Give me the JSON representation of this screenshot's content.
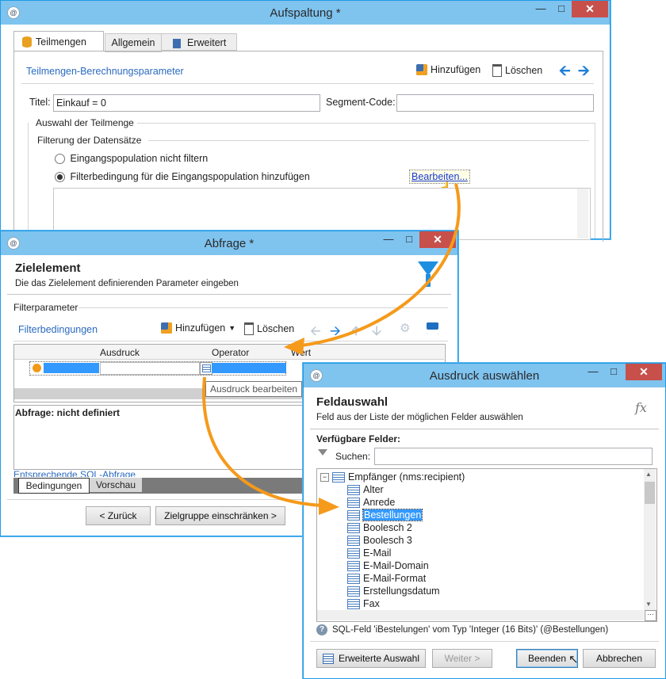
{
  "win1": {
    "title": "Aufspaltung *",
    "tabs": [
      "Teilmengen",
      "Allgemein",
      "Erweitert"
    ],
    "section_label": "Teilmengen-Berechnungsparameter",
    "add_label": "Hinzufügen",
    "delete_label": "Löschen",
    "title_label": "Titel:",
    "title_value": "Einkauf = 0",
    "segment_label": "Segment-Code:",
    "segment_value": "",
    "subset_group": "Auswahl der Teilmenge",
    "filter_group": "Filterung der Datensätze",
    "radio1": "Eingangspopulation nicht filtern",
    "radio2": "Filterbedingung für die Eingangspopulation hinzufügen",
    "edit_link": "Bearbeiten..."
  },
  "win2": {
    "title": "Abfrage *",
    "heading": "Zielelement",
    "subheading": "Die das Zielelement definierenden Parameter eingeben",
    "filter_params": "Filterparameter",
    "filter_conditions": "Filterbedingungen",
    "add_label": "Hinzufügen",
    "delete_label": "Löschen",
    "columns": [
      "Ausdruck",
      "Operator",
      "Wert"
    ],
    "tooltip": "Ausdruck bearbeiten",
    "query_status": "Abfrage: nicht definiert",
    "sql_link": "Entsprechende SQL-Abfrage",
    "bottom_tabs": [
      "Bedingungen",
      "Vorschau"
    ],
    "back_button": "< Zurück",
    "next_button": "Zielgruppe einschränken >"
  },
  "win3": {
    "title": "Ausdruck auswählen",
    "heading": "Feldauswahl",
    "subheading": "Feld aus der Liste der möglichen Felder auswählen",
    "fx_label": "fx",
    "available_fields": "Verfügbare Felder:",
    "search_label": "Suchen:",
    "search_value": "",
    "tree_root": "Empfänger (nms:recipient)",
    "fields": [
      "Alter",
      "Anrede",
      "Bestellungen",
      "Boolesch 2",
      "Boolesch 3",
      "E-Mail",
      "E-Mail-Domain",
      "E-Mail-Format",
      "Erstellungsdatum",
      "Fax"
    ],
    "selected_field": "Bestellungen",
    "info_text": "SQL-Feld 'iBestelungen' vom Typ 'Integer (16 Bits)' (@Bestellungen)",
    "advanced_button": "Erweiterte Auswahl",
    "next_button": "Weiter >",
    "finish_button": "Beenden",
    "cancel_button": "Abbrechen"
  },
  "colors": {
    "accent": "#1e9ce8",
    "titlebar": "#7fc3ef",
    "close": "#c7504b",
    "arrow": "#f59a1b",
    "selection": "#3399ff"
  }
}
